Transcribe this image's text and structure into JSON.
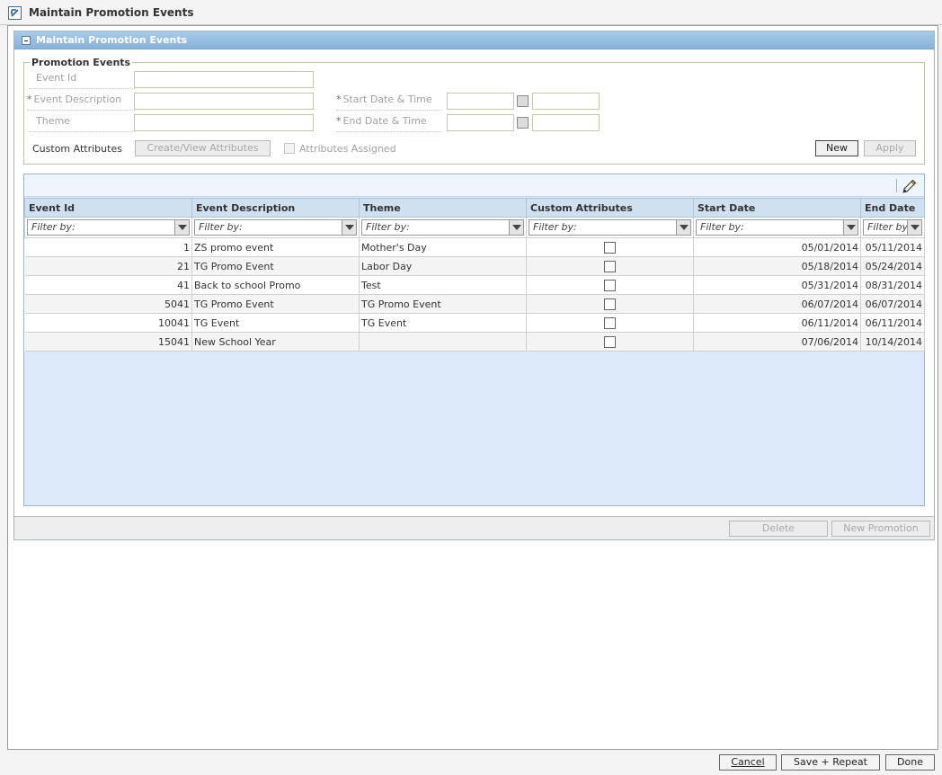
{
  "window": {
    "title": "Maintain Promotion Events"
  },
  "panel": {
    "title": "Maintain Promotion Events"
  },
  "form": {
    "legend": "Promotion Events",
    "event_id_label": "Event Id",
    "event_description_label": "Event Description",
    "theme_label": "Theme",
    "start_label": "Start Date & Time",
    "end_label": "End Date & Time",
    "required_mark": "*",
    "custom_attributes_label": "Custom Attributes",
    "create_view_button": "Create/View Attributes",
    "attributes_assigned_label": "Attributes Assigned",
    "new_button": "New",
    "apply_button": "Apply"
  },
  "grid": {
    "columns": [
      "Event Id",
      "Event Description",
      "Theme",
      "Custom Attributes",
      "Start Date",
      "End Date"
    ],
    "filter_placeholder": "Filter by:",
    "end_filter_placeholder": "Filter by",
    "rows": [
      {
        "id": "1",
        "description": "ZS promo event",
        "theme": "Mother's Day",
        "custom": false,
        "start": "05/01/2014",
        "end": "05/11/2014"
      },
      {
        "id": "21",
        "description": "TG Promo Event",
        "theme": "Labor Day",
        "custom": false,
        "start": "05/18/2014",
        "end": "05/24/2014"
      },
      {
        "id": "41",
        "description": "Back to school Promo",
        "theme": "Test",
        "custom": false,
        "start": "05/31/2014",
        "end": "08/31/2014"
      },
      {
        "id": "5041",
        "description": "TG Promo Event",
        "theme": "TG Promo Event",
        "custom": false,
        "start": "06/07/2014",
        "end": "06/07/2014"
      },
      {
        "id": "10041",
        "description": "TG Event",
        "theme": "TG Event",
        "custom": false,
        "start": "06/11/2014",
        "end": "06/11/2014"
      },
      {
        "id": "15041",
        "description": "New School Year",
        "theme": "",
        "custom": false,
        "start": "07/06/2014",
        "end": "10/14/2014"
      }
    ]
  },
  "panel_footer": {
    "delete_button": "Delete",
    "new_promotion_button": "New Promotion"
  },
  "bottom": {
    "cancel_button": "Cancel",
    "save_repeat_button": "Save + Repeat",
    "done_button": "Done"
  }
}
